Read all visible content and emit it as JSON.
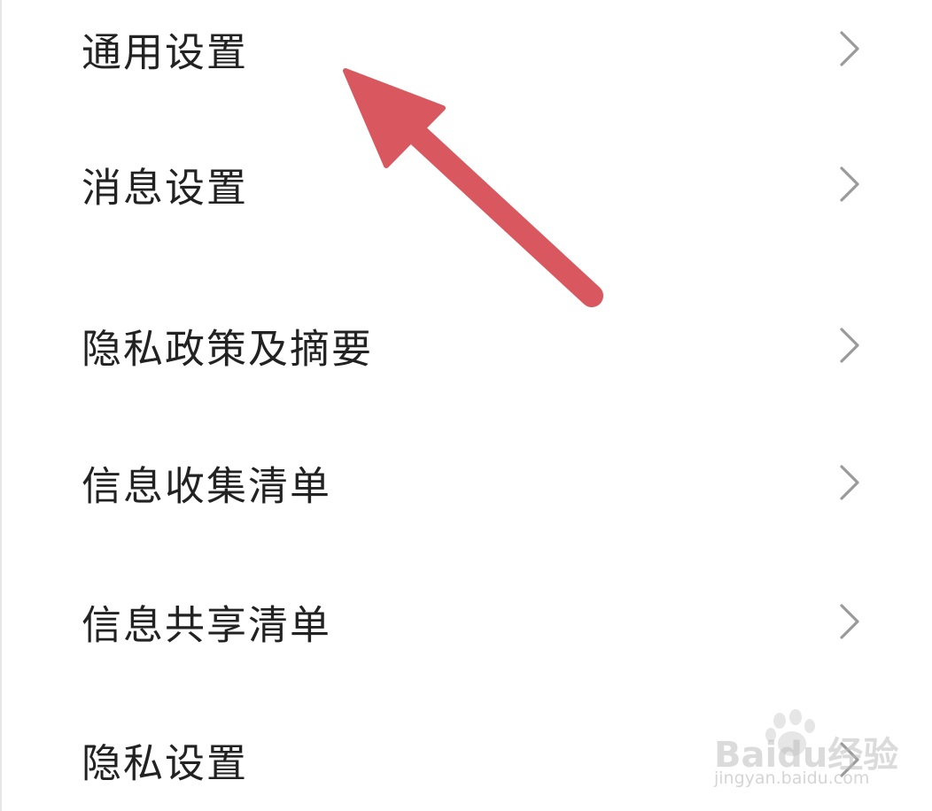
{
  "menu": {
    "items": [
      {
        "label": "通用设置",
        "icon": "chevron-right-icon"
      },
      {
        "label": "消息设置",
        "icon": "chevron-right-icon"
      },
      {
        "label": "隐私政策及摘要",
        "icon": "chevron-right-icon"
      },
      {
        "label": "信息收集清单",
        "icon": "chevron-right-icon"
      },
      {
        "label": "信息共享清单",
        "icon": "chevron-right-icon"
      },
      {
        "label": "隐私设置",
        "icon": "chevron-right-icon"
      }
    ]
  },
  "annotation": {
    "arrow_color": "#d9575e",
    "points_to": "通用设置"
  },
  "watermark": {
    "brand": "Baidu经验",
    "domain": "jingyan.baidu.com"
  },
  "colors": {
    "text": "#222222",
    "chevron": "#9a9a9a",
    "background": "#ffffff"
  }
}
